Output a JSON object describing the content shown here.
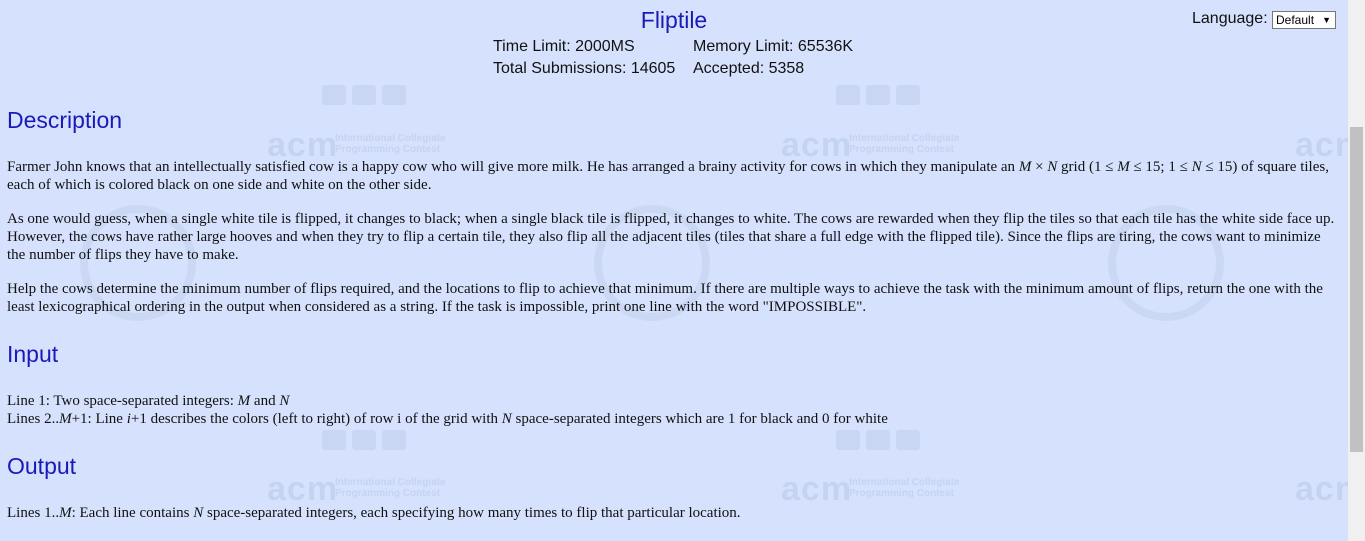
{
  "problem": {
    "title": "Fliptile",
    "time_limit": "Time Limit: 2000MS",
    "memory_limit": "Memory Limit: 65536K",
    "total_submissions": "Total Submissions: 14605",
    "accepted": "Accepted: 5358"
  },
  "language": {
    "label": "Language:",
    "selected": "Default"
  },
  "watermark": {
    "acm": "acm",
    "line1": "International Collegiate",
    "line2": "Programming Contest"
  },
  "sections": {
    "description_heading": "Description",
    "description_p1_a": "Farmer John knows that an intellectually satisfied cow is a happy cow who will give more milk. He has arranged a brainy activity for cows in which they manipulate an ",
    "description_p1_m": "M",
    "description_p1_b": " × ",
    "description_p1_n": "N",
    "description_p1_c": " grid (1 ≤ ",
    "description_p1_m2": "M",
    "description_p1_d": " ≤ 15; 1 ≤ ",
    "description_p1_n2": "N",
    "description_p1_e": " ≤ 15) of square tiles, each of which is colored black on one side and white on the other side.",
    "description_p2": "As one would guess, when a single white tile is flipped, it changes to black; when a single black tile is flipped, it changes to white. The cows are rewarded when they flip the tiles so that each tile has the white side face up. However, the cows have rather large hooves and when they try to flip a certain tile, they also flip all the adjacent tiles (tiles that share a full edge with the flipped tile). Since the flips are tiring, the cows want to minimize the number of flips they have to make.",
    "description_p3": "Help the cows determine the minimum number of flips required, and the locations to flip to achieve that minimum. If there are multiple ways to achieve the task with the minimum amount of flips, return the one with the least lexicographical ordering in the output when considered as a string. If the task is impossible, print one line with the word \"IMPOSSIBLE\".",
    "input_heading": "Input",
    "input_l1_a": "Line 1: Two space-separated integers: ",
    "input_l1_m": "M",
    "input_l1_b": " and ",
    "input_l1_n": "N",
    "input_l2_a": "Lines 2..",
    "input_l2_m": "M",
    "input_l2_b": "+1: Line ",
    "input_l2_i": "i",
    "input_l2_c": "+1 describes the colors (left to right) of row i of the grid with ",
    "input_l2_n": "N",
    "input_l2_d": " space-separated integers which are 1 for black and 0 for white",
    "output_heading": "Output",
    "output_l1_a": "Lines 1..",
    "output_l1_m": "M",
    "output_l1_b": ": Each line contains ",
    "output_l1_n": "N",
    "output_l1_c": " space-separated integers, each specifying how many times to flip that particular location."
  }
}
